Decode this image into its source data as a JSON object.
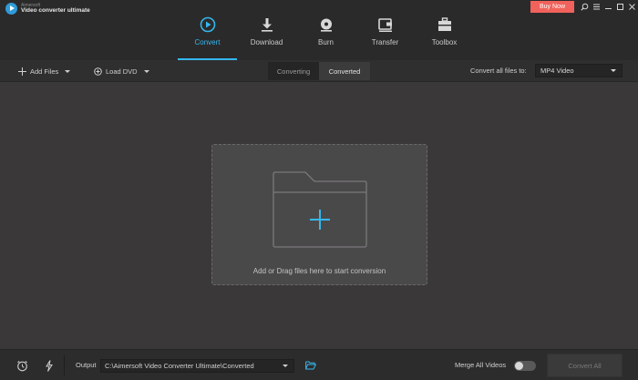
{
  "app": {
    "brand_small": "Aimersoft",
    "brand_name": "Video converter ultimate"
  },
  "window": {
    "buy_label": "Buy Now"
  },
  "modules": [
    {
      "label": "Convert",
      "icon": "convert-icon"
    },
    {
      "label": "Download",
      "icon": "download-icon"
    },
    {
      "label": "Burn",
      "icon": "burn-icon"
    },
    {
      "label": "Transfer",
      "icon": "transfer-icon"
    },
    {
      "label": "Toolbox",
      "icon": "toolbox-icon"
    }
  ],
  "toolbar": {
    "add_files": "Add Files",
    "load_dvd": "Load DVD",
    "tabs": [
      "Converting",
      "Converted"
    ],
    "convert_all_label": "Convert all files to:",
    "format": "MP4 Video"
  },
  "dropzone": {
    "hint": "Add or Drag files here to start conversion"
  },
  "bottom": {
    "output_label": "Output",
    "output_path": "C:\\Aimersoft Video Converter Ultimate\\Converted",
    "merge_label": "Merge All Videos",
    "merge_enabled": false,
    "convert_all_button": "Convert All"
  },
  "colors": {
    "accent": "#35b7ec",
    "buy": "#f0625b",
    "background": "#3a3839"
  }
}
